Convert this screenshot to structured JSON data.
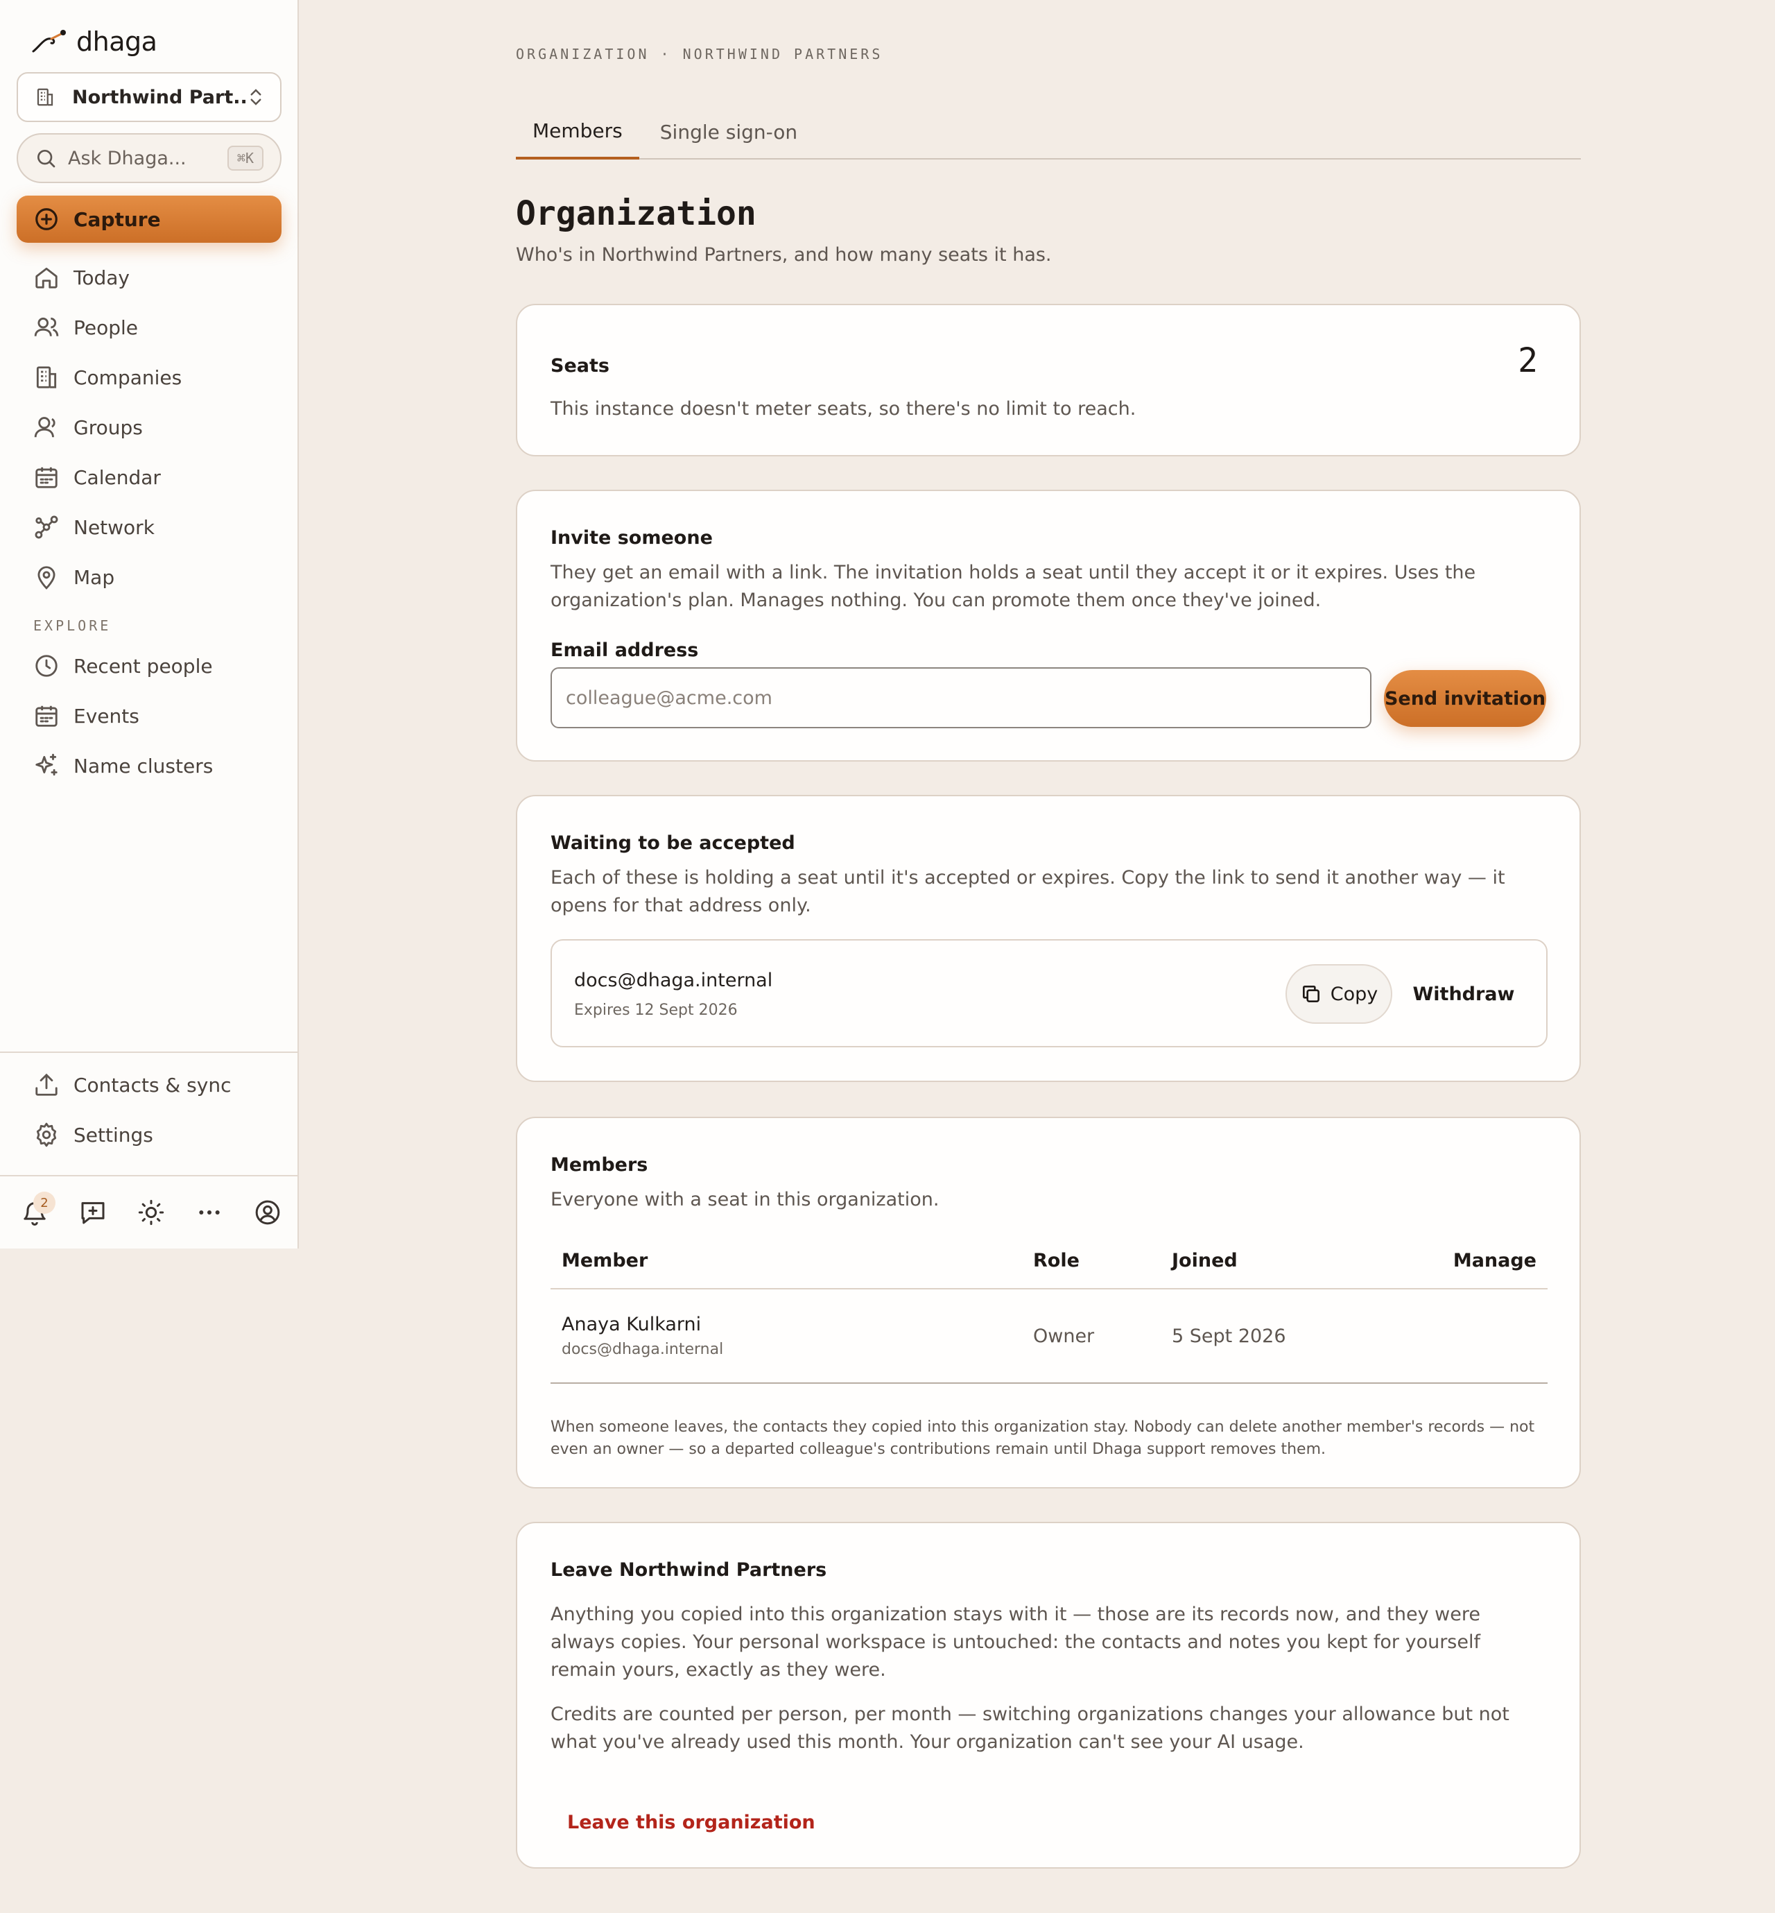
{
  "app": {
    "logo_text": "dhaga",
    "org_switcher_label": "Northwind Part...",
    "ask_placeholder": "Ask Dhaga...",
    "ask_shortcut": "⌘K",
    "capture_label": "Capture"
  },
  "sidebar": {
    "items": [
      {
        "label": "Today",
        "icon": "home-icon"
      },
      {
        "label": "People",
        "icon": "people-icon"
      },
      {
        "label": "Companies",
        "icon": "building-icon"
      },
      {
        "label": "Groups",
        "icon": "group-icon"
      },
      {
        "label": "Calendar",
        "icon": "calendar-icon"
      },
      {
        "label": "Network",
        "icon": "network-icon"
      },
      {
        "label": "Map",
        "icon": "map-pin-icon"
      }
    ],
    "explore_label": "EXPLORE",
    "explore_items": [
      {
        "label": "Recent people",
        "icon": "clock-icon"
      },
      {
        "label": "Events",
        "icon": "calendar-icon"
      },
      {
        "label": "Name clusters",
        "icon": "sparkle-icon"
      }
    ],
    "bottom_items": [
      {
        "label": "Contacts & sync",
        "icon": "upload-icon"
      },
      {
        "label": "Settings",
        "icon": "gear-icon"
      }
    ],
    "notifications_count": "2"
  },
  "header": {
    "breadcrumb": "ORGANIZATION · NORTHWIND PARTNERS",
    "tabs": [
      {
        "label": "Members",
        "active": true
      },
      {
        "label": "Single sign-on",
        "active": false
      }
    ],
    "title": "Organization",
    "subtitle": "Who's in Northwind Partners, and how many seats it has."
  },
  "seats": {
    "title": "Seats",
    "count": "2",
    "description": "This instance doesn't meter seats, so there's no limit to reach."
  },
  "invite": {
    "title": "Invite someone",
    "description": "They get an email with a link. The invitation holds a seat until they accept it or it expires. Uses the organization's plan. Manages nothing. You can promote them once they've joined.",
    "email_label": "Email address",
    "email_value": "",
    "email_placeholder": "colleague@acme.com",
    "send_label": "Send invitation"
  },
  "pending": {
    "title": "Waiting to be accepted",
    "description": "Each of these is holding a seat until it's accepted or expires. Copy the link to send it another way — it opens for that address only.",
    "items": [
      {
        "email": "docs@dhaga.internal",
        "expires": "Expires 12 Sept 2026"
      }
    ],
    "copy_label": "Copy",
    "withdraw_label": "Withdraw"
  },
  "members": {
    "title": "Members",
    "description": "Everyone with a seat in this organization.",
    "columns": [
      "Member",
      "Role",
      "Joined",
      "Manage"
    ],
    "rows": [
      {
        "name": "Anaya Kulkarni",
        "email": "docs@dhaga.internal",
        "role": "Owner",
        "joined": "5 Sept 2026",
        "manage": ""
      }
    ],
    "note": "When someone leaves, the contacts they copied into this organization stay. Nobody can delete another member's records — not even an owner — so a departed colleague's contributions remain until Dhaga support removes them."
  },
  "leave": {
    "title": "Leave Northwind Partners",
    "paragraph1": "Anything you copied into this organization stays with it — those are its records now, and they were always copies. Your personal workspace is untouched: the contacts and notes you kept for yourself remain yours, exactly as they were.",
    "paragraph2": "Credits are counted per person, per month — switching organizations changes your allowance but not what you've already used this month. Your organization can't see your AI usage.",
    "button_label": "Leave this organization"
  },
  "colors": {
    "accent": "#d67a33",
    "danger": "#b3241a",
    "background": "#f3ece5",
    "surface": "#fffefd"
  }
}
